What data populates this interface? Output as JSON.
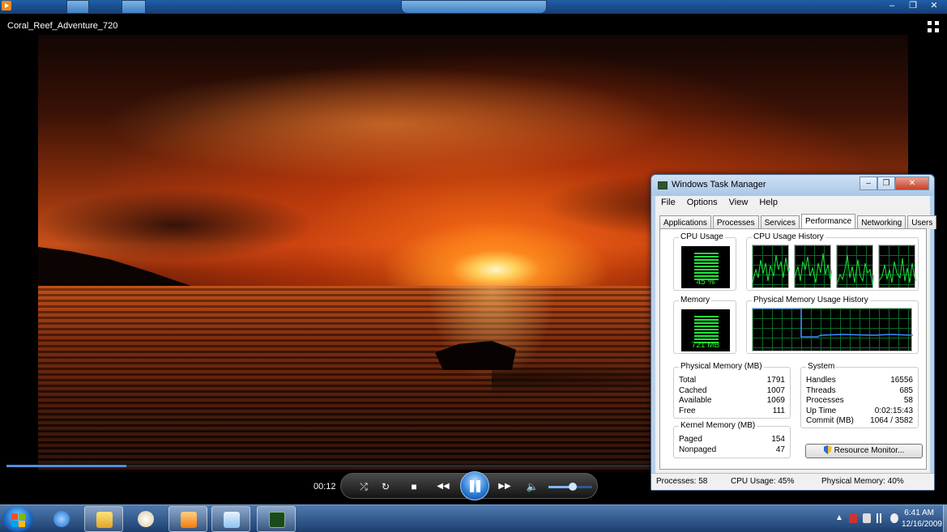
{
  "window": {
    "min": "–",
    "max": "❐",
    "close": "✕"
  },
  "player": {
    "title": "Coral_Reef_Adventure_720",
    "elapsed": "00:12",
    "seek_progress": 0.13,
    "volume_level": 0.55,
    "controls": {
      "shuffle": "⤮",
      "repeat": "↻",
      "stop": "■",
      "rewind": "◀◀",
      "forward": "▶▶",
      "volume": "🔈"
    }
  },
  "task_manager": {
    "title": "Windows Task Manager",
    "menu": [
      "File",
      "Options",
      "View",
      "Help"
    ],
    "tabs": [
      "Applications",
      "Processes",
      "Services",
      "Performance",
      "Networking",
      "Users"
    ],
    "active_tab": "Performance",
    "cpu_usage": {
      "title": "CPU Usage",
      "value": "45 %"
    },
    "cpu_history": {
      "title": "CPU Usage History"
    },
    "memory": {
      "title": "Memory",
      "value": "721 MB"
    },
    "memory_history": {
      "title": "Physical Memory Usage History"
    },
    "physical_memory": {
      "title": "Physical Memory (MB)",
      "rows": [
        {
          "label": "Total",
          "value": "1791"
        },
        {
          "label": "Cached",
          "value": "1007"
        },
        {
          "label": "Available",
          "value": "1069"
        },
        {
          "label": "Free",
          "value": "111"
        }
      ]
    },
    "kernel_memory": {
      "title": "Kernel Memory (MB)",
      "rows": [
        {
          "label": "Paged",
          "value": "154"
        },
        {
          "label": "Nonpaged",
          "value": "47"
        }
      ]
    },
    "system": {
      "title": "System",
      "rows": [
        {
          "label": "Handles",
          "value": "16556"
        },
        {
          "label": "Threads",
          "value": "685"
        },
        {
          "label": "Processes",
          "value": "58"
        },
        {
          "label": "Up Time",
          "value": "0:02:15:43"
        },
        {
          "label": "Commit (MB)",
          "value": "1064 / 3582"
        }
      ]
    },
    "resource_monitor_label": "Resource Monitor...",
    "status": {
      "processes": "Processes: 58",
      "cpu": "CPU Usage: 45%",
      "memory": "Physical Memory: 40%"
    }
  },
  "taskbar": {
    "clock_time": "6:41 AM",
    "clock_date": "12/16/2009",
    "tray_up_arrow": "▲",
    "pinned": [
      "internet-explorer",
      "windows-explorer",
      "paint",
      "windows-media-player",
      "notepad",
      "task-manager"
    ]
  },
  "colors": {
    "graph_green": "#1fe63a",
    "memory_line": "#3a8cff",
    "taskbar": "#1c3e6e",
    "accent": "#4f8fe0"
  }
}
